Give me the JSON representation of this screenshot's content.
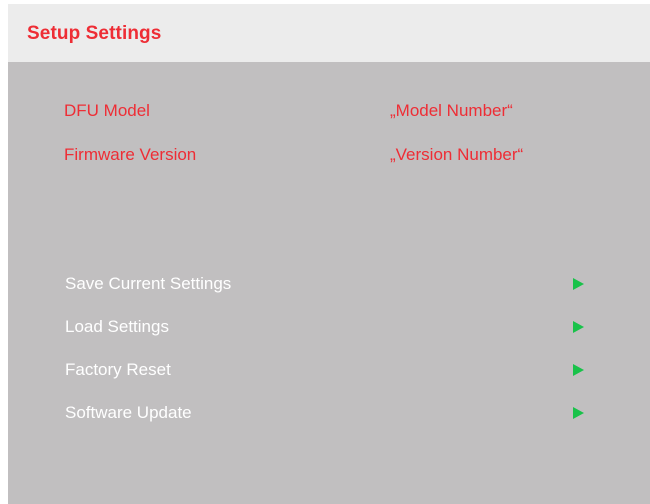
{
  "header": {
    "title": "Setup Settings"
  },
  "info": [
    {
      "label": "DFU Model",
      "value": "„Model Number“"
    },
    {
      "label": "Firmware Version",
      "value": "„Version Number“"
    }
  ],
  "menu": [
    {
      "label": "Save Current Settings",
      "icon": "arrow-right-icon"
    },
    {
      "label": "Load Settings",
      "icon": "arrow-right-icon"
    },
    {
      "label": "Factory Reset",
      "icon": "arrow-right-icon"
    },
    {
      "label": "Software Update",
      "icon": "arrow-right-icon"
    }
  ],
  "colors": {
    "accent": "#ee2d35",
    "panel_bg": "#c1bfc0",
    "header_bg": "#ececec",
    "menu_text": "#ffffff",
    "arrow": "#19c24a"
  }
}
